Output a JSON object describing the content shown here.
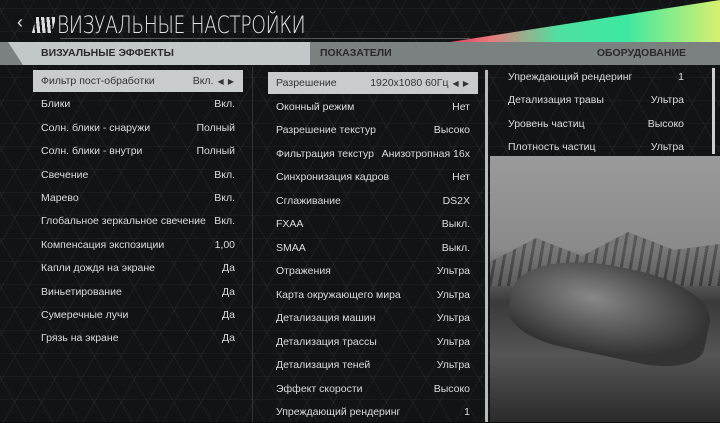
{
  "header": {
    "title": "ВИЗУАЛЬНЫЕ НАСТРОЙКИ",
    "back": "‹"
  },
  "tabs": [
    {
      "label": "ВИЗУАЛЬНЫЕ ЭФФЕКТЫ"
    },
    {
      "label": "ПОКАЗАТЕЛИ"
    },
    {
      "label": "ОБОРУДОВАНИЕ"
    }
  ],
  "left": [
    {
      "label": "Фильтр пост-обработки",
      "value": "Вкл."
    },
    {
      "label": "Блики",
      "value": "Вкл."
    },
    {
      "label": "Солн. блики - снаружи",
      "value": "Полный"
    },
    {
      "label": "Солн. блики - внутри",
      "value": "Полный"
    },
    {
      "label": "Свечение",
      "value": "Вкл."
    },
    {
      "label": "Марево",
      "value": "Вкл."
    },
    {
      "label": "Глобальное зеркальное свечение",
      "value": "Вкл."
    },
    {
      "label": "Компенсация экспозиции",
      "value": "1,00"
    },
    {
      "label": "Капли дождя на экране",
      "value": "Да"
    },
    {
      "label": "Виньетирование",
      "value": "Да"
    },
    {
      "label": "Сумеречные лучи",
      "value": "Да"
    },
    {
      "label": "Грязь на экране",
      "value": "Да"
    }
  ],
  "middle": [
    {
      "label": "Разрешение",
      "value": "1920x1080 60Гц"
    },
    {
      "label": "Оконный режим",
      "value": "Нет"
    },
    {
      "label": "Разрешение текстур",
      "value": "Высоко"
    },
    {
      "label": "Фильтрация текстур",
      "value": "Анизотропная 16x"
    },
    {
      "label": "Синхронизация кадров",
      "value": "Нет"
    },
    {
      "label": "Сглаживание",
      "value": "DS2X"
    },
    {
      "label": "FXAA",
      "value": "Выкл."
    },
    {
      "label": "SMAA",
      "value": "Выкл."
    },
    {
      "label": "Отражения",
      "value": "Ультра"
    },
    {
      "label": "Карта окружающего мира",
      "value": "Ультра"
    },
    {
      "label": "Детализация машин",
      "value": "Ультра"
    },
    {
      "label": "Детализация трассы",
      "value": "Ультра"
    },
    {
      "label": "Детализация теней",
      "value": "Ультра"
    },
    {
      "label": "Эффект скорости",
      "value": "Высоко"
    },
    {
      "label": "Упреждающий рендеринг",
      "value": "1"
    }
  ],
  "right": [
    {
      "label": "Упреждающий рендеринг",
      "value": "1"
    },
    {
      "label": "Детализация травы",
      "value": "Ультра"
    },
    {
      "label": "Уровень частиц",
      "value": "Высоко"
    },
    {
      "label": "Плотность частиц",
      "value": "Ультра"
    }
  ],
  "icons": {
    "arrows": "◀ ▶"
  }
}
